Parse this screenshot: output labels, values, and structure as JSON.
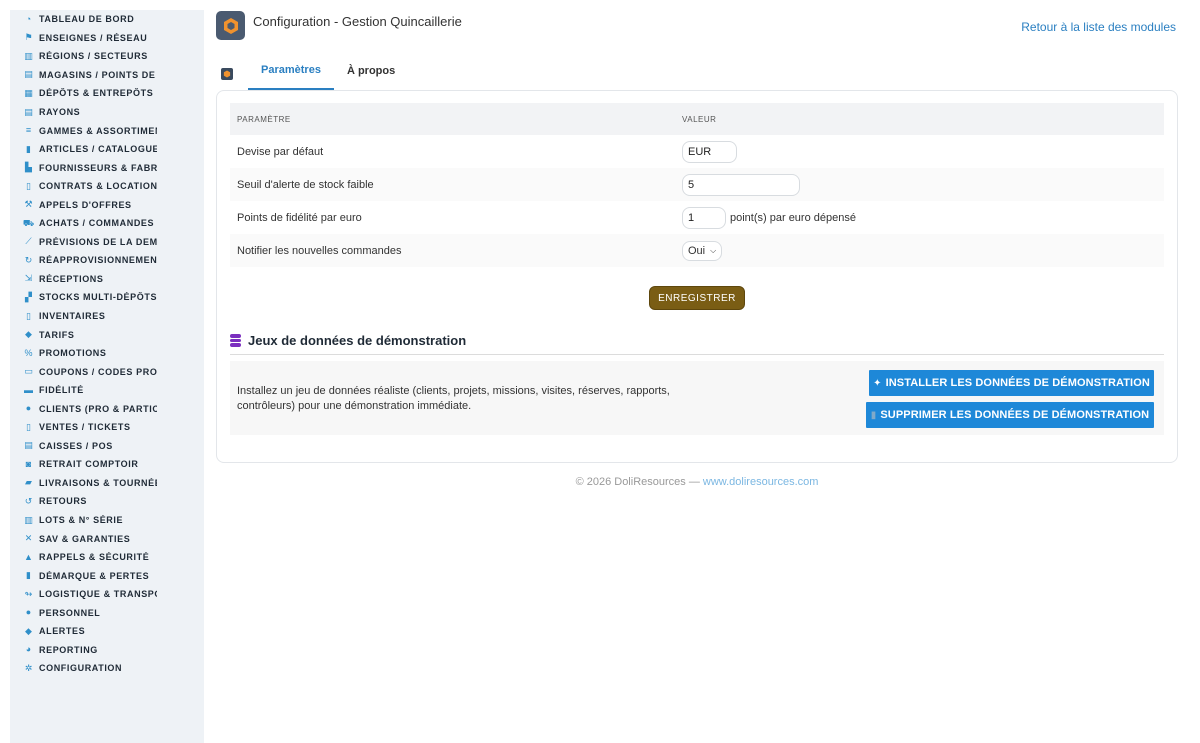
{
  "sidebar": {
    "items": [
      {
        "label": "TABLEAU DE BORD",
        "icon": "dashboard-icon"
      },
      {
        "label": "ENSEIGNES / RÉSEAU",
        "icon": "flag-icon"
      },
      {
        "label": "RÉGIONS / SECTEURS",
        "icon": "map-icon"
      },
      {
        "label": "MAGASINS / POINTS DE V",
        "icon": "store-icon"
      },
      {
        "label": "DÉPÔTS & ENTREPÔTS",
        "icon": "warehouse-icon"
      },
      {
        "label": "RAYONS",
        "icon": "shelf-icon"
      },
      {
        "label": "GAMMES & ASSORTIMENT",
        "icon": "layers-icon"
      },
      {
        "label": "ARTICLES / CATALOGUE",
        "icon": "book-icon"
      },
      {
        "label": "FOURNISSEURS & FABRI",
        "icon": "factory-icon"
      },
      {
        "label": "CONTRATS & LOCATION",
        "icon": "contract-icon"
      },
      {
        "label": "APPELS D'OFFRES",
        "icon": "gavel-icon"
      },
      {
        "label": "ACHATS / COMMANDES F",
        "icon": "cart-icon"
      },
      {
        "label": "PRÉVISIONS DE LA DEMA",
        "icon": "chart-line-icon"
      },
      {
        "label": "RÉAPPROVISIONNEMENT",
        "icon": "sync-icon"
      },
      {
        "label": "RÉCEPTIONS",
        "icon": "dolly-icon"
      },
      {
        "label": "STOCKS MULTI-DÉPÔTS",
        "icon": "boxes-icon"
      },
      {
        "label": "INVENTAIRES",
        "icon": "clipboard-icon"
      },
      {
        "label": "TARIFS",
        "icon": "tag-icon"
      },
      {
        "label": "PROMOTIONS",
        "icon": "percent-icon"
      },
      {
        "label": "COUPONS / CODES PROM",
        "icon": "ticket-icon"
      },
      {
        "label": "FIDÉLITÉ",
        "icon": "card-icon"
      },
      {
        "label": "CLIENTS (PRO & PARTICU",
        "icon": "user-icon"
      },
      {
        "label": "VENTES / TICKETS",
        "icon": "receipt-icon"
      },
      {
        "label": "CAISSES / POS",
        "icon": "cash-register-icon"
      },
      {
        "label": "RETRAIT COMPTOIR",
        "icon": "car-icon"
      },
      {
        "label": "LIVRAISONS & TOURNÉES",
        "icon": "truck-icon"
      },
      {
        "label": "RETOURS",
        "icon": "undo-icon"
      },
      {
        "label": "LOTS & N° SÉRIE",
        "icon": "barcode-icon"
      },
      {
        "label": "SAV & GARANTIES",
        "icon": "tools-icon"
      },
      {
        "label": "RAPPELS & SÉCURITÉ",
        "icon": "warning-icon"
      },
      {
        "label": "DÉMARQUE & PERTES",
        "icon": "trash-icon"
      },
      {
        "label": "LOGISTIQUE & TRANSPO",
        "icon": "route-icon"
      },
      {
        "label": "PERSONNEL",
        "icon": "users-icon"
      },
      {
        "label": "ALERTES",
        "icon": "bell-icon"
      },
      {
        "label": "REPORTING",
        "icon": "pie-chart-icon"
      },
      {
        "label": "CONFIGURATION",
        "icon": "gear-icon"
      }
    ]
  },
  "header": {
    "title": "Configuration - Gestion Quincaillerie",
    "back_link": "Retour à la liste des modules"
  },
  "tabs": [
    {
      "label": "Paramètres",
      "active": true
    },
    {
      "label": "À propos",
      "active": false
    }
  ],
  "params": {
    "col_param": "PARAMÈTRE",
    "col_value": "VALEUR",
    "rows": [
      {
        "label": "Devise par défaut",
        "value": "EUR"
      },
      {
        "label": "Seuil d'alerte de stock faible",
        "value": "5"
      },
      {
        "label": "Points de fidélité par euro",
        "value": "1",
        "unit": "point(s) par euro dépensé"
      },
      {
        "label": "Notifier les nouvelles commandes",
        "value": "Oui"
      }
    ],
    "save_label": "ENREGISTRER"
  },
  "demo": {
    "title": "Jeux de données de démonstration",
    "description": "Installez un jeu de données réaliste (clients, projets, missions, visites, réserves, rapports, contrôleurs) pour une démonstration immédiate.",
    "install_label": "INSTALLER LES DONNÉES DE DÉMONSTRATION",
    "delete_label": "SUPPRIMER LES DONNÉES DE DÉMONSTRATION"
  },
  "footer": {
    "text": "© 2026 DoliResources — ",
    "link": "www.doliresources.com"
  },
  "colors": {
    "accent": "#2a7fc1",
    "icon_blue": "#2f8fc9",
    "save_button": "#7a5d14",
    "action_button": "#1e88d8",
    "demo_icon": "#7b2fbf",
    "logo_orange": "#f0922e"
  }
}
